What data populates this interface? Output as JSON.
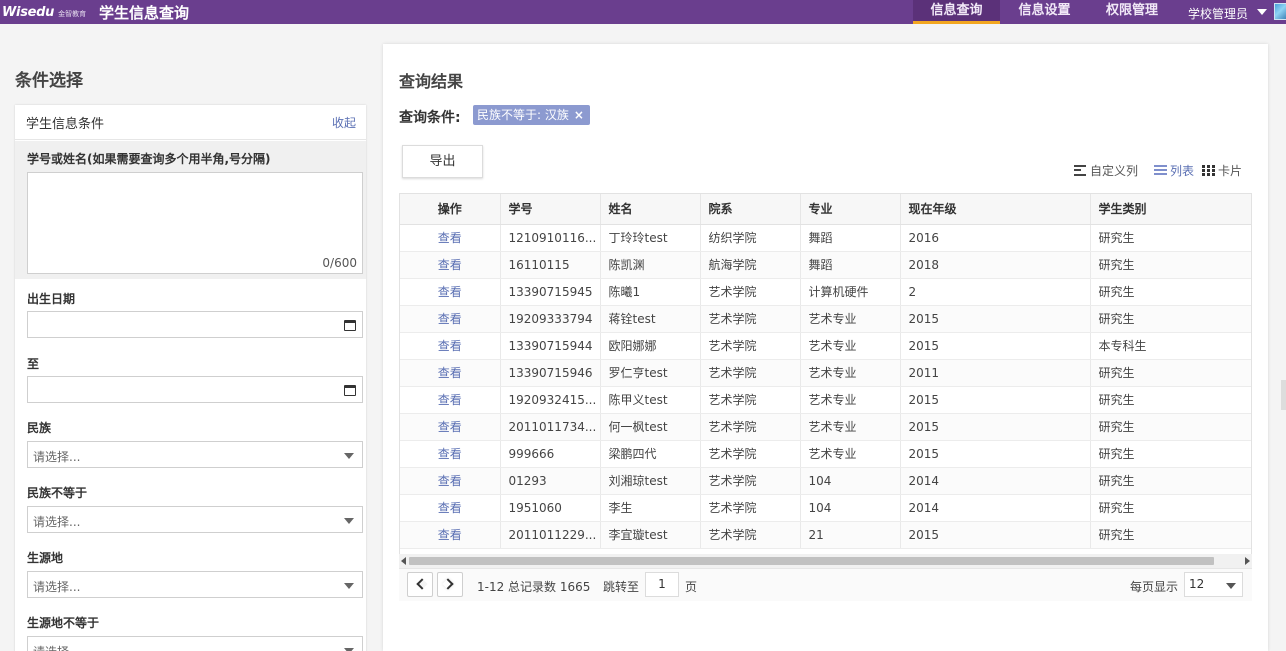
{
  "header": {
    "logo_text": "Wisedu",
    "logo_sub": "金智教育",
    "app_title": "学生信息查询",
    "nav": [
      "信息查询",
      "信息设置",
      "权限管理"
    ],
    "active_nav": "信息查询",
    "user": "学校管理员",
    "colors": {
      "bar": "#6a3e8e",
      "active_underline": "#f2a61f"
    }
  },
  "left": {
    "section_title": "条件选择",
    "card_title": "学生信息条件",
    "collapse": "收起",
    "id_or_name_label": "学号或姓名(如果需要查询多个用半角,号分隔)",
    "id_or_name_counter": "0/600",
    "birth_label": "出生日期",
    "to_label": "至",
    "selects": [
      {
        "label": "民族",
        "placeholder": "请选择..."
      },
      {
        "label": "民族不等于",
        "placeholder": "请选择..."
      },
      {
        "label": "生源地",
        "placeholder": "请选择..."
      },
      {
        "label": "生源地不等于",
        "placeholder": "请选择..."
      }
    ]
  },
  "right": {
    "title": "查询结果",
    "cond_label": "查询条件:",
    "tag": "民族不等于: 汉族",
    "tag_close": "×",
    "export": "导出",
    "view_options": {
      "custom": "自定义列",
      "list": "列表",
      "card": "卡片"
    },
    "columns": [
      "操作",
      "学号",
      "姓名",
      "院系",
      "专业",
      "现在年级",
      "学生类别"
    ],
    "rows": [
      [
        "查看",
        "1210910116...",
        "丁玲玲test",
        "纺织学院",
        "舞蹈",
        "2016",
        "研究生"
      ],
      [
        "查看",
        "16110115",
        "陈凯渊",
        "航海学院",
        "舞蹈",
        "2018",
        "研究生"
      ],
      [
        "查看",
        "13390715945",
        "陈曦1",
        "艺术学院",
        "计算机硬件",
        "2",
        "研究生"
      ],
      [
        "查看",
        "19209333794",
        "蒋铨test",
        "艺术学院",
        "艺术专业",
        "2015",
        "研究生"
      ],
      [
        "查看",
        "13390715944",
        "欧阳娜娜",
        "艺术学院",
        "艺术专业",
        "2015",
        "本专科生"
      ],
      [
        "查看",
        "13390715946",
        "罗仁亨test",
        "艺术学院",
        "艺术专业",
        "2011",
        "研究生"
      ],
      [
        "查看",
        "1920932415...",
        "陈甲义test",
        "艺术学院",
        "艺术专业",
        "2015",
        "研究生"
      ],
      [
        "查看",
        "2011011734...",
        "何一枫test",
        "艺术学院",
        "艺术专业",
        "2015",
        "研究生"
      ],
      [
        "查看",
        "999666",
        "梁鹏四代",
        "艺术学院",
        "艺术专业",
        "2015",
        "研究生"
      ],
      [
        "查看",
        "01293",
        "刘湘琼test",
        "艺术学院",
        "104",
        "2014",
        "研究生"
      ],
      [
        "查看",
        "1951060",
        "李生",
        "艺术学院",
        "104",
        "2014",
        "研究生"
      ],
      [
        "查看",
        "2011011229...",
        "李宜璇test",
        "艺术学院",
        "21",
        "2015",
        "研究生"
      ]
    ],
    "pager": {
      "summary": "1-12 总记录数 1665",
      "jump_label": "跳转至",
      "page_value": "1",
      "page_unit": "页",
      "per_page_label": "每页显示",
      "per_page_value": "12"
    }
  }
}
